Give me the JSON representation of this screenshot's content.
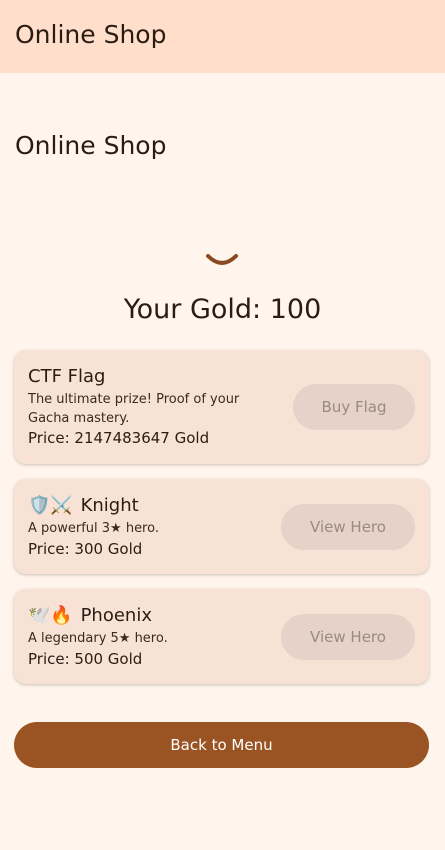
{
  "appbar": {
    "title": "Online Shop"
  },
  "page": {
    "heading": "Online Shop"
  },
  "gold": {
    "label": "Your Gold: 100"
  },
  "items": [
    {
      "title": "CTF Flag",
      "icon": "",
      "description_line1": "The ultimate prize! Proof of your",
      "description_line2": "Gacha mastery.",
      "price": "Price: 2147483647 Gold",
      "button": "Buy Flag"
    },
    {
      "title": "Knight",
      "icon": "🛡️⚔️",
      "description_line1": "A powerful 3★ hero.",
      "price": "Price: 300 Gold",
      "button": "View Hero"
    },
    {
      "title": "Phoenix",
      "icon": "🕊️🔥",
      "description_line1": "A legendary 5★ hero.",
      "price": "Price: 500 Gold",
      "button": "View Hero"
    }
  ],
  "back_button": {
    "label": "Back to Menu"
  },
  "colors": {
    "background": "#fff5ec",
    "appbar": "#ffdfcb",
    "card": "#f8e2d6",
    "disabled_button": "#e6d2c8",
    "primary": "#9a5322"
  }
}
